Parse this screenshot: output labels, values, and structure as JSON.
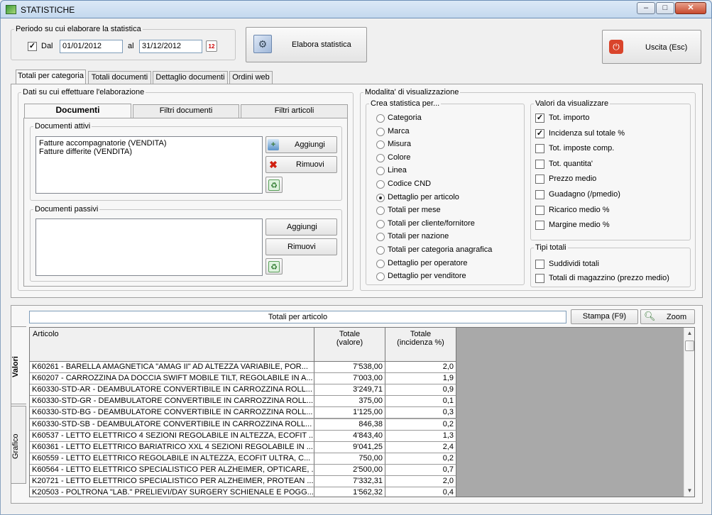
{
  "window": {
    "title": "STATISTICHE"
  },
  "period": {
    "legend": "Periodo su cui elaborare la statistica",
    "dal_label": "Dal",
    "dal_checked": true,
    "from": "01/01/2012",
    "al_label": "al",
    "to": "31/12/2012"
  },
  "buttons": {
    "elabora": "Elabora statistica",
    "uscita": "Uscita (Esc)"
  },
  "main_tabs": [
    "Totali per categoria",
    "Totali documenti",
    "Dettaglio documenti",
    "Ordini web"
  ],
  "left": {
    "legend": "Dati su cui effettuare l'elaborazione",
    "subtabs": [
      "Documenti",
      "Filtri documenti",
      "Filtri articoli"
    ],
    "attivi": {
      "legend": "Documenti attivi",
      "items": [
        "Fatture accompagnatorie (VENDITA)",
        "Fatture differite (VENDITA)"
      ],
      "aggiungi": "Aggiungi",
      "rimuovi": "Rimuovi"
    },
    "passivi": {
      "legend": "Documenti passivi",
      "aggiungi": "Aggiungi",
      "rimuovi": "Rimuovi"
    }
  },
  "modalita": {
    "legend": "Modalita' di visualizzazione",
    "crea": {
      "legend": "Crea statistica per...",
      "options": [
        "Categoria",
        "Marca",
        "Misura",
        "Colore",
        "Linea",
        "Codice CND",
        "Dettaglio per articolo",
        "Totali per mese",
        "Totali per cliente/fornitore",
        "Totali per nazione",
        "Totali per categoria anagrafica",
        "Dettaglio per operatore",
        "Dettaglio per venditore"
      ],
      "selected": "Dettaglio per articolo"
    },
    "valori": {
      "legend": "Valori da visualizzare",
      "items": [
        {
          "label": "Tot. importo",
          "checked": true
        },
        {
          "label": "Incidenza sul totale %",
          "checked": true
        },
        {
          "label": "Tot. imposte comp.",
          "checked": false
        },
        {
          "label": "Tot. quantita'",
          "checked": false
        },
        {
          "label": "Prezzo medio",
          "checked": false
        },
        {
          "label": "Guadagno (/pmedio)",
          "checked": false
        },
        {
          "label": "Ricarico medio %",
          "checked": false
        },
        {
          "label": "Margine medio %",
          "checked": false
        }
      ]
    },
    "tipi": {
      "legend": "Tipi totali",
      "items": [
        {
          "label": "Suddividi totali",
          "checked": false
        },
        {
          "label": "Totali di magazzino (prezzo medio)",
          "checked": false
        }
      ]
    }
  },
  "results": {
    "title": "Totali per articolo",
    "stampa": "Stampa (F9)",
    "zoom": "Zoom",
    "side_tabs": [
      "Valori",
      "Grafico"
    ],
    "columns": [
      "Articolo",
      "Totale\n(valore)",
      "Totale\n(incidenza %)"
    ],
    "rows": [
      [
        "K60261 - BARELLA AMAGNETICA \"AMAG II\" AD ALTEZZA VARIABILE, POR...",
        "7'538,00",
        "2,0"
      ],
      [
        "K60207 - CARROZZINA DA DOCCIA SWIFT MOBILE TILT, REGOLABILE IN A...",
        "7'003,00",
        "1,9"
      ],
      [
        "K60330-STD-AR - DEAMBULATORE CONVERTIBILE IN CARROZZINA ROLL...",
        "3'249,71",
        "0,9"
      ],
      [
        "K60330-STD-GR - DEAMBULATORE CONVERTIBILE IN CARROZZINA ROLL...",
        "375,00",
        "0,1"
      ],
      [
        "K60330-STD-BG - DEAMBULATORE CONVERTIBILE IN CARROZZINA ROLL...",
        "1'125,00",
        "0,3"
      ],
      [
        "K60330-STD-SB - DEAMBULATORE CONVERTIBILE IN CARROZZINA ROLL...",
        "846,38",
        "0,2"
      ],
      [
        "K60537 - LETTO ELETTRICO 4 SEZIONI REGOLABILE IN ALTEZZA, ECOFIT ...",
        "4'843,40",
        "1,3"
      ],
      [
        "K60361 - LETTO ELETTRICO BARIATRICO XXL 4 SEZIONI REGOLABILE IN ...",
        "9'041,25",
        "2,4"
      ],
      [
        "K60559 - LETTO ELETTRICO REGOLABILE IN ALTEZZA, ECOFIT ULTRA, C...",
        "750,00",
        "0,2"
      ],
      [
        "K60564 - LETTO ELETTRICO SPECIALISTICO PER ALZHEIMER, OPTICARE, ...",
        "2'500,00",
        "0,7"
      ],
      [
        "K20721 - LETTO ELETTRICO SPECIALISTICO PER ALZHEIMER, PROTEAN ...",
        "7'332,31",
        "2,0"
      ],
      [
        "K20503 - POLTRONA \"LAB.\" PRELIEVI/DAY SURGERY SCHIENALE E POGG...",
        "1'562,32",
        "0,4"
      ]
    ]
  }
}
